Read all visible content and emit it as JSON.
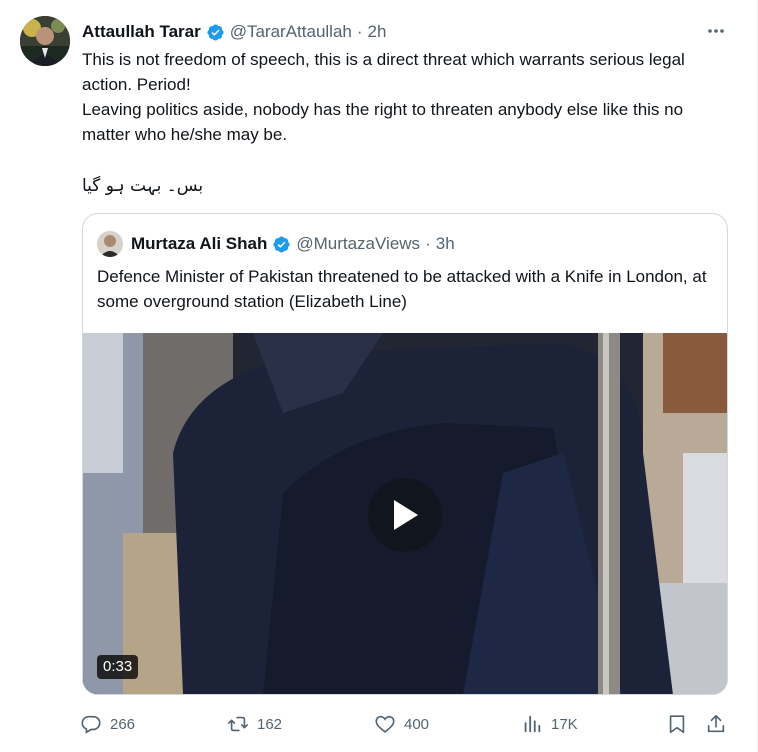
{
  "tweet": {
    "author_name": "Attaullah Tarar",
    "author_handle": "@TararAttaullah",
    "separator": "·",
    "time": "2h",
    "text_line1": "This is not freedom of speech, this is a direct threat which warrants serious legal action. Period!",
    "text_line2": "Leaving politics aside, nobody has the right to threaten anybody else like this no matter who he/she may be.",
    "text_urdu": "بس۔ بہت ہو گیا"
  },
  "quoted_tweet": {
    "author_name": "Murtaza Ali Shah",
    "author_handle": "@MurtazaViews",
    "separator": "·",
    "time": "3h",
    "text": "Defence Minister of Pakistan threatened to be attacked with a Knife in London, at some overground station (Elizabeth Line)",
    "video_duration": "0:33"
  },
  "actions": {
    "replies": "266",
    "retweets": "162",
    "likes": "400",
    "views": "17K"
  },
  "colors": {
    "verified": "#1d9bf0",
    "muted_text": "#536471",
    "border": "#cfd9de"
  },
  "icons": [
    "verified-badge-icon",
    "more-icon",
    "play-icon",
    "reply-icon",
    "retweet-icon",
    "like-icon",
    "views-icon",
    "bookmark-icon",
    "share-icon"
  ]
}
